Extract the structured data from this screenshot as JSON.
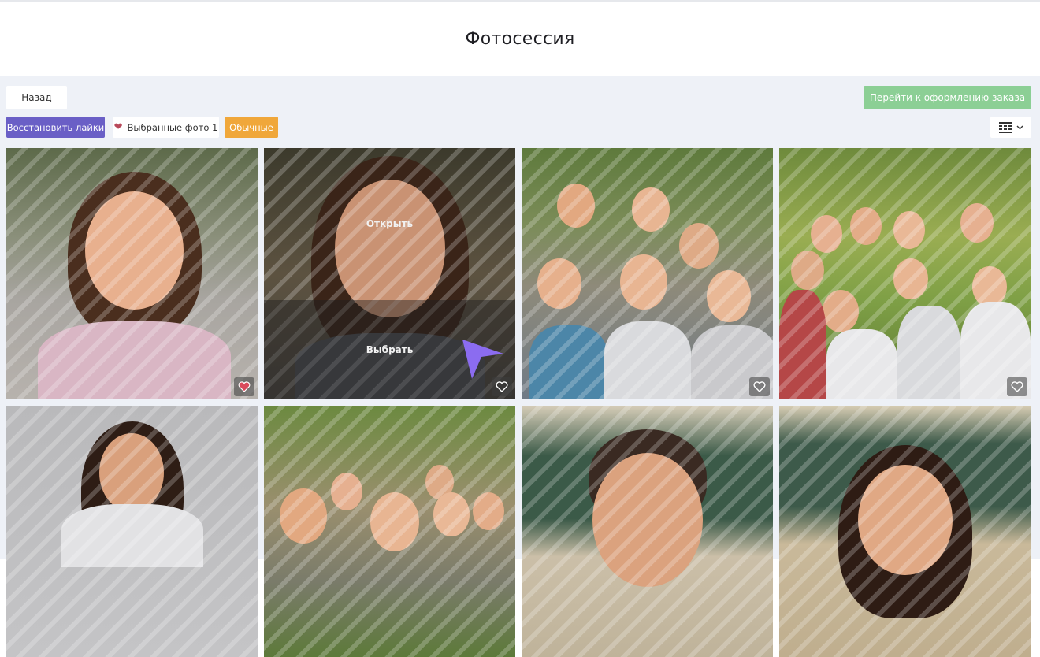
{
  "page": {
    "title": "Фотосессия"
  },
  "toolbar": {
    "back_label": "Назад",
    "order_label": "Перейти к оформлению заказа",
    "restore_likes_label": "Восстановить лайки",
    "favorites_label": "Выбранные фото 1",
    "regular_label": "Обычные",
    "view_icon": "grid-view-icon",
    "view_chevron": "chevron-down-icon"
  },
  "gallery": {
    "hover_overlay": {
      "open_label": "Открыть",
      "select_label": "Выбрать"
    },
    "photos": [
      {
        "id": "photo-1",
        "liked": true,
        "subject": "girl-portrait-park"
      },
      {
        "id": "photo-2",
        "liked": false,
        "subject": "girl-portrait-closeup"
      },
      {
        "id": "photo-3",
        "liked": false,
        "subject": "kids-group-school"
      },
      {
        "id": "photo-4",
        "liked": false,
        "subject": "kids-group-park"
      },
      {
        "id": "photo-5",
        "liked": false,
        "subject": "girl-grey-backdrop"
      },
      {
        "id": "photo-6",
        "liked": false,
        "subject": "kids-group-house"
      },
      {
        "id": "photo-7",
        "liked": false,
        "subject": "boy-classroom"
      },
      {
        "id": "photo-8",
        "liked": false,
        "subject": "girl-classroom"
      }
    ]
  },
  "colors": {
    "accent_purple": "#6a5fc6",
    "order_green": "#8ccf95",
    "regular_orange": "#f0a73a",
    "panel_bg": "#eef1f7",
    "heart_liked": "#d94a5c"
  }
}
